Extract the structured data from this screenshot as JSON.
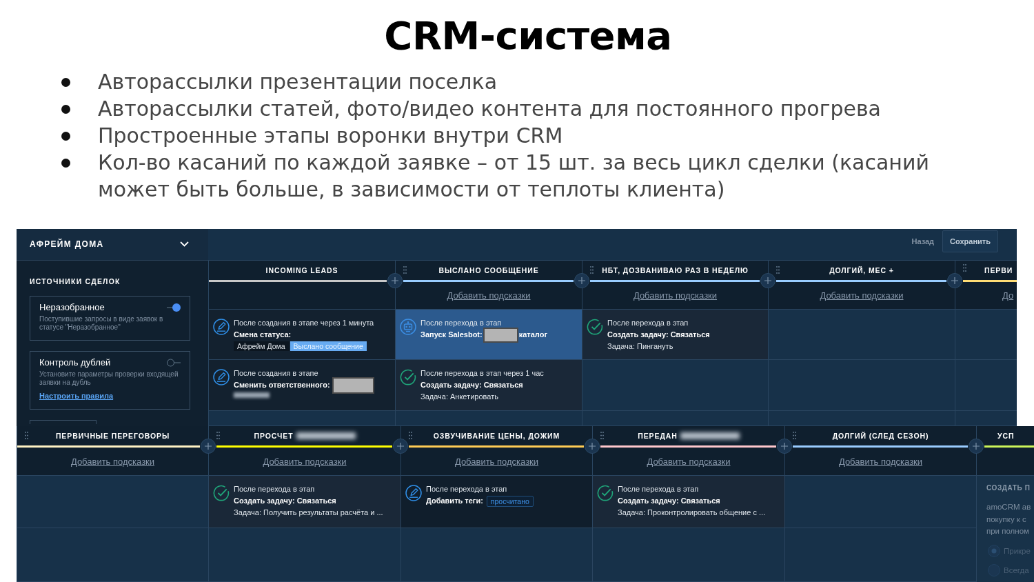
{
  "title": "CRM-система",
  "bullets": [
    "Авторассылки презентации поселка",
    "Авторассылки статей, фото/видео контента для постоянного прогрева",
    "Простроенные этапы воронки внутри CRM",
    "Кол-во касаний по каждой заявке – от 15 шт. за весь цикл сделки (касаний может быть больше, в зависимости от теплоты клиента)"
  ],
  "screen_1": {
    "sidebar": {
      "pipeline": "АФРЕЙМ ДОМА",
      "section": "ИСТОЧНИКИ СДЕЛОК",
      "sources": [
        {
          "title": "Неразобранное",
          "description": "Поступившие запросы в виде заявок в статусе \"Неразобранное\"",
          "on": true
        },
        {
          "title": "Контроль дублей",
          "description": "Установите параметры проверки входящей заявки на дубль",
          "link": "Настроить правила",
          "on": false
        }
      ]
    },
    "toolbar": {
      "back": "Назад",
      "save": "Сохранить"
    },
    "stages": [
      {
        "name": "INCOMING LEADS",
        "redacted": false,
        "color": "#c8c8c8",
        "draggable": false,
        "triggers": [
          {
            "kind": "status",
            "selected": false,
            "condition": "После создания в этапе через 1 минута",
            "action": "Смена статуса:",
            "pipeline": "Афрейм Дома",
            "status": "Выслано сообщение"
          },
          {
            "kind": "responsible",
            "selected": false,
            "condition": "После создания в этапе",
            "action": "Сменить ответственного:"
          }
        ]
      },
      {
        "name": "ВЫСЛАНО СООБЩЕНИЕ",
        "redacted": false,
        "color": "#99ccff",
        "draggable": true,
        "hint": "Добавить подсказки",
        "triggers": [
          {
            "kind": "salesbot",
            "selected": true,
            "condition": "После перехода в этап",
            "action": "Запуск Salesbot:",
            "bot": "каталог"
          },
          {
            "kind": "task",
            "selected": false,
            "condition": "После перехода в этап через 1 час",
            "action": "Создать задачу: Связаться",
            "task": "Задача: Анкетировать"
          }
        ]
      },
      {
        "name": "НБТ, ДОЗВАНИВАЮ РАЗ В НЕДЕЛЮ",
        "redacted": false,
        "color": "#99ccff",
        "draggable": true,
        "hint": "Добавить подсказки",
        "triggers": [
          {
            "kind": "task",
            "selected": false,
            "condition": "После перехода в этап",
            "action": "Создать задачу: Связаться",
            "task": "Задача: Пингануть"
          }
        ]
      },
      {
        "name": "ДОЛГИЙ, МЕС +",
        "redacted": false,
        "color": "#99ccff",
        "draggable": true,
        "hint": "Добавить подсказки"
      },
      {
        "name": "ПЕРВИ",
        "redacted": false,
        "color": "#ffdd75",
        "draggable": true,
        "hint": "До"
      }
    ]
  },
  "screen_2": {
    "stages": [
      {
        "name": "ПЕРВИЧНЫЕ ПЕРЕГОВОРЫ",
        "redacted": false,
        "color": "#fff2c4",
        "draggable": true,
        "hint": "Добавить подсказки"
      },
      {
        "name": "ПРОСЧЕТ",
        "redacted": true,
        "color": "#ffff00",
        "draggable": true,
        "hint": "Добавить подсказки",
        "triggers": [
          {
            "kind": "task",
            "selected": false,
            "condition": "После перехода в этап",
            "action": "Создать задачу: Связаться",
            "task": "Задача: Получить результаты расчёта и ..."
          }
        ]
      },
      {
        "name": "ОЗВУЧИВАНИЕ ЦЕНЫ, ДОЖИМ",
        "redacted": false,
        "color": "#ffcc55",
        "draggable": true,
        "hint": "Добавить подсказки",
        "triggers": [
          {
            "kind": "tags",
            "selected": false,
            "condition": "После перехода в этап",
            "action": "Добавить теги:",
            "tags": [
              "просчитано"
            ]
          }
        ]
      },
      {
        "name": "ПЕРЕДАН",
        "redacted": true,
        "color": "#ffc7cc",
        "draggable": true,
        "hint": "Добавить подсказки",
        "triggers": [
          {
            "kind": "task",
            "selected": false,
            "condition": "После перехода в этап",
            "action": "Создать задачу: Связаться",
            "task": "Задача: Проконтролировать общение с ..."
          }
        ]
      },
      {
        "name": "ДОЛГИЙ (СЛЕД СЕЗОН)",
        "redacted": false,
        "color": "#99ccff",
        "draggable": true,
        "hint": "Добавить подсказки"
      },
      {
        "name": "УСП",
        "redacted": false,
        "color": "#ccf55a",
        "draggable": false,
        "panel": {
          "heading": "СОЗДАТЬ П",
          "lines": [
            "amoCRM ав",
            "покупку к с",
            "при полном"
          ],
          "options": [
            {
              "label": "Прикре",
              "selected": true
            },
            {
              "label": "Всегда",
              "selected": false
            }
          ]
        }
      }
    ]
  }
}
